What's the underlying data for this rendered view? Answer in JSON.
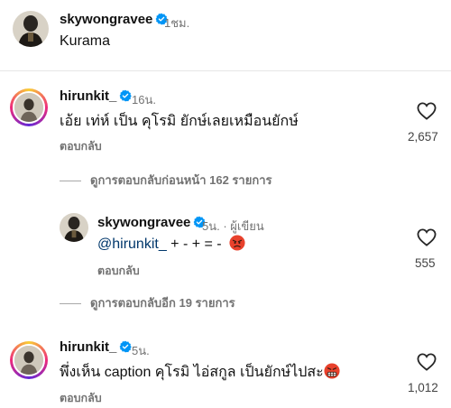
{
  "post": {
    "username": "skywongravee",
    "time": "1ชม.",
    "caption": "Kurama"
  },
  "comments": [
    {
      "username": "hirunkit_",
      "time": "16น.",
      "text": "เอ้ย เท่ห์ เป็น คุโรมิ ยักษ์เลยเหมือนยักษ์",
      "reply_label": "ตอบกลับ",
      "likes": "2,657",
      "view_replies": "ดูการตอบกลับก่อนหน้า 162 รายการ"
    },
    {
      "username": "skywongravee",
      "time": "5น.",
      "author_tag": "ผู้เขียน",
      "mention": "@hirunkit_",
      "text": " + - + = -",
      "emoji": "angry-face-emoji",
      "reply_label": "ตอบกลับ",
      "likes": "555",
      "view_replies": "ดูการตอบกลับอีก 19 รายการ"
    },
    {
      "username": "hirunkit_",
      "time": "5น.",
      "text": "พึ่งเห็น caption คุโรมิ ไอ่สกูล เป็นยักษ์ไปสะ",
      "emoji": "grimacing-angry-emoji",
      "reply_label": "ตอบกลับ",
      "likes": "1,012"
    }
  ],
  "colors": {
    "verified": "#0095f6",
    "secondary_text": "#737373",
    "mention": "#00376b"
  }
}
